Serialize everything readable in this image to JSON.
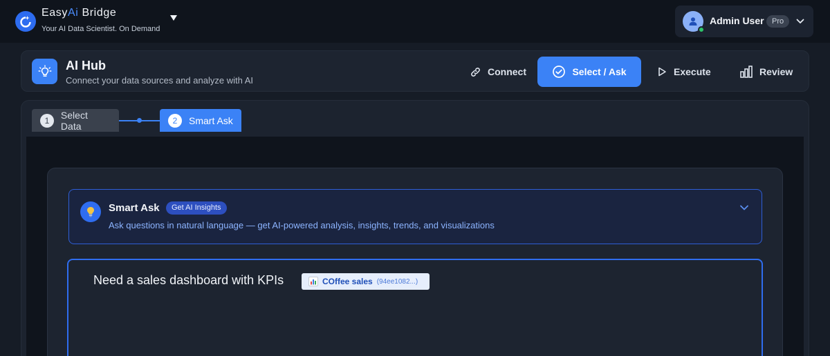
{
  "brand": {
    "name_prefix": "Easy",
    "name_ai": "Ai",
    "name_suffix": " Bridge",
    "tagline": "Your AI Data Scientist. On Demand"
  },
  "user": {
    "name": "Admin User",
    "plan": "Pro"
  },
  "hub": {
    "title": "AI Hub",
    "subtitle": "Connect your data sources and analyze with AI",
    "nav": [
      {
        "label": "Connect",
        "icon": "link-icon"
      },
      {
        "label": "Select / Ask",
        "icon": "check-circle-icon",
        "active": true
      },
      {
        "label": "Execute",
        "icon": "play-icon"
      },
      {
        "label": "Review",
        "icon": "bar-chart-icon"
      }
    ]
  },
  "steps": [
    {
      "number": "1",
      "label": "Select Data"
    },
    {
      "number": "2",
      "label": "Smart Ask",
      "active": true
    }
  ],
  "smart_ask": {
    "title": "Smart Ask",
    "badge": "Get AI Insights",
    "description": "Ask questions in natural language — get AI-powered analysis, insights, trends, and visualizations"
  },
  "prompt": {
    "text": "Need a sales dashboard with KPIs",
    "chip": {
      "icon": "bar-chart-emoji-icon",
      "name": "COffee sales",
      "id": "(94ee1082...)"
    }
  },
  "colors": {
    "accent": "#3b82f6",
    "background": "#161c26",
    "online": "#2ec46a"
  }
}
